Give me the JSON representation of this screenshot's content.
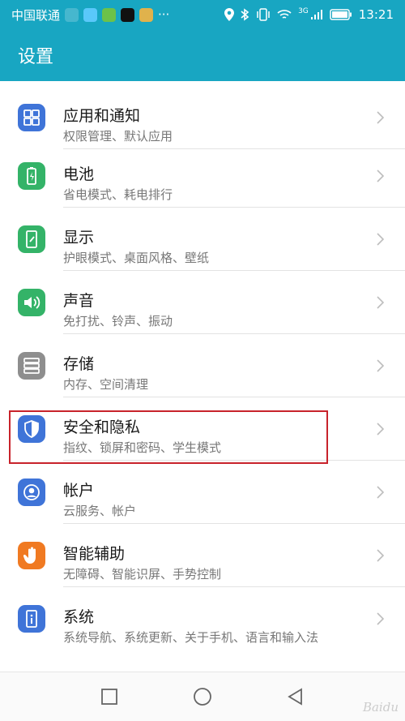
{
  "status_bar": {
    "carrier": "中国联通",
    "more": "···",
    "network": "3G",
    "time": "13:21"
  },
  "header": {
    "title": "设置"
  },
  "items": [
    {
      "icon": "apps-grid-icon",
      "color": "#3f74d8",
      "title": "应用和通知",
      "subtitle": "权限管理、默认应用"
    },
    {
      "icon": "battery-icon",
      "color": "#34b368",
      "title": "电池",
      "subtitle": "省电模式、耗电排行"
    },
    {
      "icon": "display-icon",
      "color": "#34b368",
      "title": "显示",
      "subtitle": "护眼模式、桌面风格、壁纸"
    },
    {
      "icon": "speaker-icon",
      "color": "#34b368",
      "title": "声音",
      "subtitle": "免打扰、铃声、振动"
    },
    {
      "icon": "storage-icon",
      "color": "#8e8e8e",
      "title": "存储",
      "subtitle": "内存、空间清理"
    },
    {
      "icon": "shield-icon",
      "color": "#3f74d8",
      "title": "安全和隐私",
      "subtitle": "指纹、锁屏和密码、学生模式"
    },
    {
      "icon": "account-icon",
      "color": "#3f74d8",
      "title": "帐户",
      "subtitle": "云服务、帐户"
    },
    {
      "icon": "hand-icon",
      "color": "#f07a22",
      "title": "智能辅助",
      "subtitle": "无障碍、智能识屏、手势控制"
    },
    {
      "icon": "info-icon",
      "color": "#3f74d8",
      "title": "系统",
      "subtitle": "系统导航、系统更新、关于手机、语言和输入法"
    }
  ],
  "colors": {
    "accent": "#18a6c2",
    "highlight": "#c8232b"
  }
}
